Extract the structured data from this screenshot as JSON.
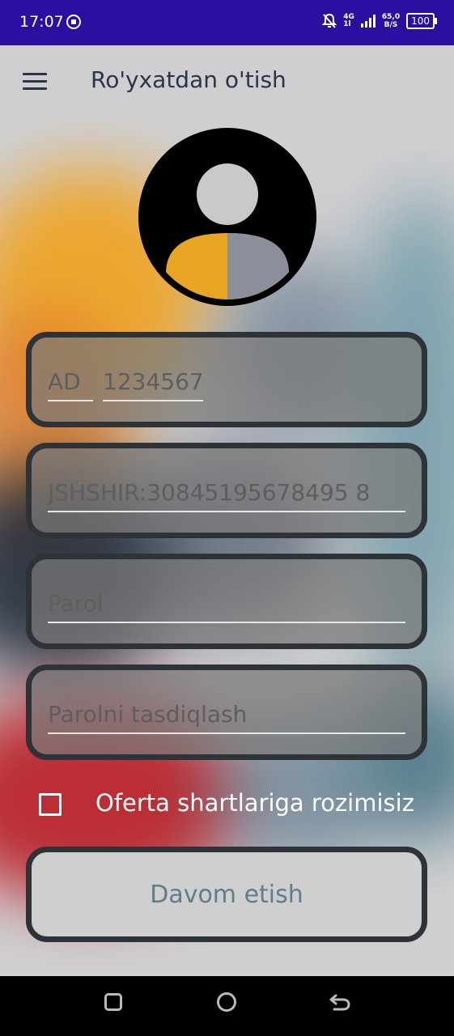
{
  "status_bar": {
    "time": "17:07",
    "network_top": "4G",
    "network_bottom": "1l",
    "speed_value": "65,0",
    "speed_unit": "B/S",
    "battery": "100",
    "icons": [
      "screen-record-icon",
      "mute-icon",
      "signal-icon",
      "battery-icon"
    ]
  },
  "app_bar": {
    "title": "Ro'yxatdan o'tish",
    "menu_icon": "hamburger-menu-icon"
  },
  "avatar": {
    "icon": "user-avatar-icon"
  },
  "form": {
    "passport_series_placeholder": "AD",
    "passport_number_placeholder": "1234567",
    "jshshir_placeholder": "JSHSHIR:30845195678495 8",
    "password_placeholder": "Parol",
    "confirm_password_placeholder": "Parolni tasdiqlash",
    "agree_label": "Oferta shartlariga rozimisiz",
    "agree_checked": false
  },
  "continue_button": "Davom etish",
  "colors": {
    "status_bar": "#2a0fa0",
    "field_border": "#2e3338",
    "button_text": "#607d8b",
    "title_text": "#2a3547"
  }
}
